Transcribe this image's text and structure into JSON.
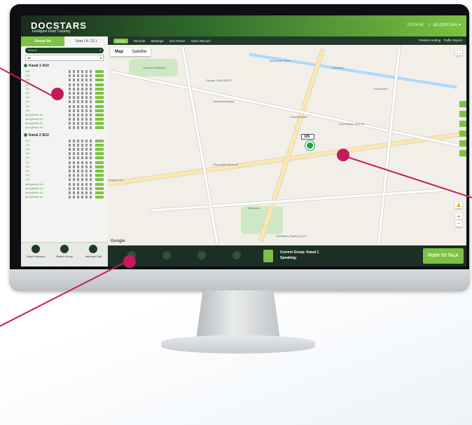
{
  "app": {
    "logo": "DOCSTARS",
    "logo_tagline": "Intelligent Fleet Tracking",
    "user": "dp1@tkf.bike ▾",
    "time": "00:04:42"
  },
  "sidebar": {
    "tabs": [
      "Group list",
      "User ( 4 / 12 )"
    ],
    "search_placeholder": "Search",
    "filter_value": "All",
    "groups": [
      {
        "name": "Kanal 1",
        "count": "4/10",
        "members": [
          "100",
          "101",
          "102",
          "110",
          "111",
          "112",
          "113",
          "114",
          "115",
          "116",
          "iphrightsite-kit...",
          "iphrightsite-kit...",
          "iphrightsite-kit...",
          "iphrightsite-kit..."
        ]
      },
      {
        "name": "Kanal 2",
        "count": "8/12",
        "members": [
          "100",
          "101",
          "102",
          "110",
          "111",
          "112",
          "113",
          "114",
          "115",
          "116",
          "iphrightsite-kit...",
          "iphrightsite-kit...",
          "iphrightsite-kit...",
          "iphrightsite-kit..."
        ]
      }
    ],
    "bottom_buttons": [
      "Voice Intercom",
      "Switch Group",
      "Interrupt Call"
    ]
  },
  "toolbar": {
    "items": [
      "Groups",
      "Records",
      "Message",
      "Geo-Fence",
      "Alarm Record"
    ],
    "right_items": [
      "Position Setting",
      "Traffic Report"
    ]
  },
  "map": {
    "types": [
      "Map",
      "Satellite"
    ],
    "marker_label": "105",
    "marker_pin_text": "5",
    "labels": [
      "Tierpark Dählhölzli",
      "Sportcenter Bern",
      "Garage CANCARES",
      "Universitätsspital",
      "Lötschenbach",
      "Europlatz",
      "Stöckacker",
      "Gymnasium Schloss",
      "Psychiatrie-Museum",
      "Bümpliz Süd",
      "Albanova",
      "Gladiators Fighting Gym"
    ],
    "attribution": "Google"
  },
  "ptt": {
    "current_group": "Current Group:  Kanal 1",
    "speaking": "Speaking:",
    "button": "PUSH TO TALK"
  },
  "colors": {
    "accent": "#7dc242",
    "dark": "#1c2f24",
    "callout": "#c6195e"
  }
}
